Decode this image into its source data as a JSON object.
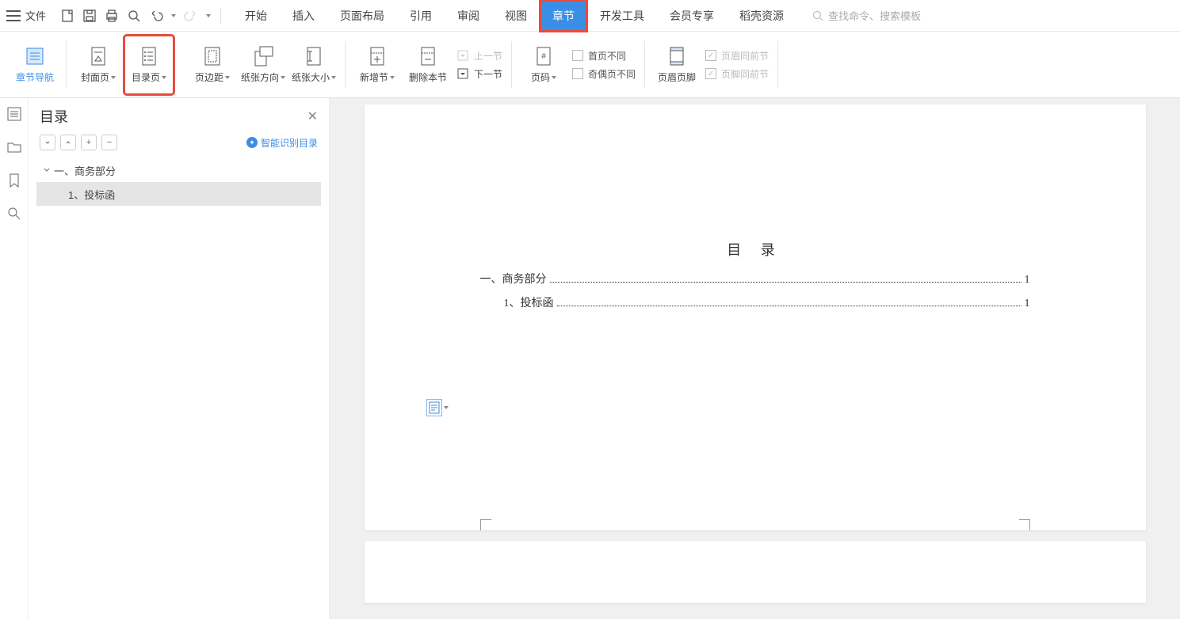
{
  "menu": {
    "file": "文件"
  },
  "tabs": [
    "开始",
    "插入",
    "页面布局",
    "引用",
    "审阅",
    "视图",
    "章节",
    "开发工具",
    "会员专享",
    "稻壳资源"
  ],
  "active_tab_index": 6,
  "search_placeholder": "查找命令、搜索模板",
  "ribbon": {
    "chapter_nav": "章节导航",
    "cover_page": "封面页",
    "toc_page": "目录页",
    "margins": "页边距",
    "orientation": "纸张方向",
    "size": "纸张大小",
    "insert_section": "新增节",
    "delete_section": "删除本节",
    "prev_section": "上一节",
    "next_section": "下一节",
    "page_number": "页码",
    "diff_first": "首页不同",
    "diff_odd_even": "奇偶页不同",
    "header_footer": "页眉页脚",
    "header_same": "页眉同前节",
    "footer_same": "页脚同前节"
  },
  "nav": {
    "title": "目录",
    "smart_recognize": "智能识别目录",
    "items": [
      {
        "label": "一、商务部分",
        "level": 1,
        "expanded": true
      },
      {
        "label": "1、投标函",
        "level": 2,
        "selected": true
      }
    ]
  },
  "document": {
    "toc_title": "目 录",
    "toc_lines": [
      {
        "num": "一、",
        "text": "商务部分",
        "page": "1",
        "level": 1
      },
      {
        "num": "1、",
        "text": "投标函",
        "page": "1",
        "level": 2
      }
    ]
  }
}
